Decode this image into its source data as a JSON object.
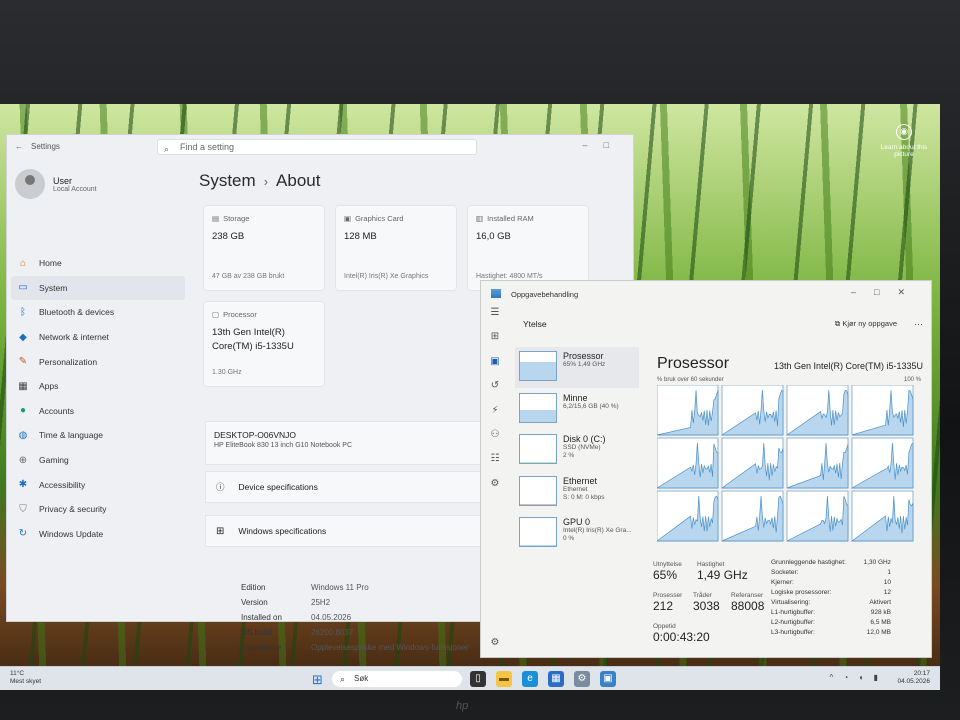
{
  "settings": {
    "title": "Settings",
    "search_placeholder": "Find a setting",
    "user": {
      "name": "User",
      "account": "Local Account"
    },
    "nav": [
      {
        "label": "Home",
        "icon": "home-icon"
      },
      {
        "label": "System",
        "icon": "monitor-icon"
      },
      {
        "label": "Bluetooth & devices",
        "icon": "bluetooth-icon"
      },
      {
        "label": "Network & internet",
        "icon": "wifi-icon"
      },
      {
        "label": "Personalization",
        "icon": "brush-icon"
      },
      {
        "label": "Apps",
        "icon": "apps-icon"
      },
      {
        "label": "Accounts",
        "icon": "person-icon"
      },
      {
        "label": "Time & language",
        "icon": "globe-icon"
      },
      {
        "label": "Gaming",
        "icon": "gamepad-icon"
      },
      {
        "label": "Accessibility",
        "icon": "accessibility-icon"
      },
      {
        "label": "Privacy & security",
        "icon": "shield-icon"
      },
      {
        "label": "Windows Update",
        "icon": "update-icon"
      }
    ],
    "breadcrumb": {
      "parent": "System",
      "current": "About"
    },
    "cards": {
      "storage": {
        "title": "Storage",
        "value": "238 GB",
        "sub": "47 GB av 238 GB brukt"
      },
      "graphics": {
        "title": "Graphics Card",
        "value": "128 MB",
        "sub": "Intel(R) Iris(R) Xe Graphics"
      },
      "ram": {
        "title": "Installed RAM",
        "value": "16,0 GB",
        "sub": "Hastighet: 4800 MT/s"
      },
      "processor": {
        "title": "Processor",
        "value": "13th Gen Intel(R) Core(TM) i5-1335U",
        "sub": "1.30 GHz"
      }
    },
    "device": {
      "name": "DESKTOP-O06VNJO",
      "model": "HP EliteBook 830 13 inch G10 Notebook PC"
    },
    "device_specs_label": "Device specifications",
    "windows_specs_label": "Windows specifications",
    "windows_specs": [
      {
        "k": "Edition",
        "v": "Windows 11 Pro"
      },
      {
        "k": "Version",
        "v": "25H2"
      },
      {
        "k": "Installed on",
        "v": "04.05.2026"
      },
      {
        "k": "OS build",
        "v": "26200.8037"
      },
      {
        "k": "Experience",
        "v": "Opplevelsespakke med Windows-funksjoner"
      }
    ]
  },
  "taskmgr": {
    "title": "Oppgavebehandling",
    "section": "Ytelse",
    "run_task": "Kjør ny oppgave",
    "more": "···",
    "perf_items": [
      {
        "name": "Prosessor",
        "sub": "65% 1,49 GHz",
        "fill": 0.65,
        "color": "#b8d6ee"
      },
      {
        "name": "Minne",
        "sub": "6,2/15,6 GB (40 %)",
        "fill": 0.4,
        "color": "#b8d6ee"
      },
      {
        "name": "Disk 0 (C:)",
        "sub": "SSD (NVMe)\n2 %",
        "fill": 0.02,
        "color": "#c8e6c0"
      },
      {
        "name": "Ethernet",
        "sub": "Ethernet\nS: 0 M: 0 kbps",
        "fill": 0.0,
        "color": "#e6b7b7"
      },
      {
        "name": "GPU 0",
        "sub": "Intel(R) Iris(R) Xe Gra...\n0 %",
        "fill": 0.03,
        "color": "#b8d6ee"
      }
    ],
    "cpu": {
      "title": "Prosessor",
      "model": "13th Gen Intel(R) Core(TM) i5-1335U",
      "graph_label": "% bruk over 60 sekunder",
      "graph_max": "100 %",
      "utilization_label": "Utnyttelse",
      "utilization": "65%",
      "speed_label": "Hastighet",
      "speed": "1,49 GHz",
      "processes_label": "Prosesser",
      "processes": "212",
      "threads_label": "Tråder",
      "threads": "3038",
      "handles_label": "Referanser",
      "handles": "88008",
      "uptime_label": "Oppetid",
      "uptime": "0:00:43:20",
      "details": [
        {
          "k": "Grunnleggende hastighet:",
          "v": "1,30 GHz"
        },
        {
          "k": "Socketer:",
          "v": "1"
        },
        {
          "k": "Kjerner:",
          "v": "10"
        },
        {
          "k": "Logiske prosessorer:",
          "v": "12"
        },
        {
          "k": "Virtualisering:",
          "v": "Aktivert"
        },
        {
          "k": "L1-hurtigbuffer:",
          "v": "928 kB"
        },
        {
          "k": "L2-hurtigbuffer:",
          "v": "6,5 MB"
        },
        {
          "k": "L3-hurtigbuffer:",
          "v": "12,0 MB"
        }
      ]
    }
  },
  "desktop": {
    "learn_about": "Learn about this picture"
  },
  "taskbar": {
    "weather_temp": "11°C",
    "weather_desc": "Mest skyet",
    "search": "Søk",
    "time": "20:17",
    "date": "04.05.2026"
  },
  "brand": "hp",
  "colors": {
    "accent": "#1a5fb4",
    "graph_fill": "#b8d6ee",
    "graph_line": "#4a90c8"
  }
}
